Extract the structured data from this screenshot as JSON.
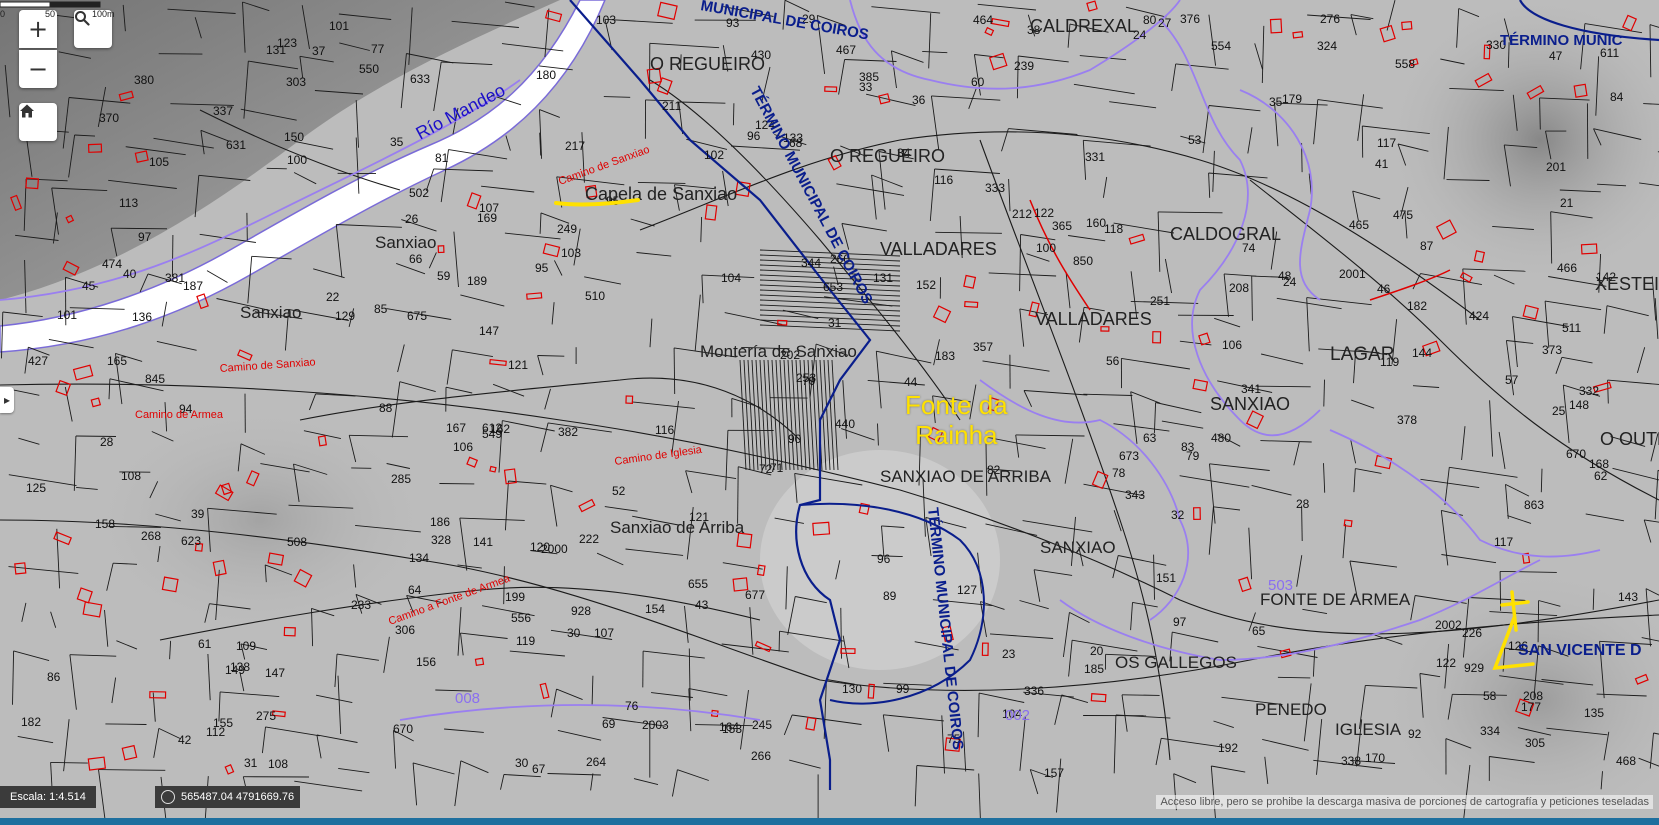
{
  "controls": {
    "zoom_in": "+",
    "zoom_out": "−",
    "search_icon": "search-icon",
    "home_icon": "home-icon"
  },
  "scale": {
    "label": "Escala: 1:4.514",
    "ticks": [
      "0",
      "50",
      "100m"
    ]
  },
  "coordinates": "565487.04  4791669.76",
  "attribution": "Acceso libre, pero se prohibe la descarga masiva de porciones de cartografía y peticiones teseladas",
  "colors": {
    "terrain": "#bdbdbd",
    "parcel_line": "#1a1a1a",
    "municipal_border": "#0a1e8c",
    "parish_border": "#9a7ff0",
    "river": "#ffffff",
    "road_label": "#e00000",
    "annotation": "#ffe100"
  },
  "places": [
    {
      "id": "o-regueiro-1",
      "text": "O REGUEIRO"
    },
    {
      "id": "o-regueiro-2",
      "text": "O REGUEIRO"
    },
    {
      "id": "caldrexal",
      "text": "CALDREXAL"
    },
    {
      "id": "caldogral",
      "text": "CALDOGRAL"
    },
    {
      "id": "valladares-1",
      "text": "VALLADARES"
    },
    {
      "id": "valladares-2",
      "text": "VALLADARES"
    },
    {
      "id": "lagar",
      "text": "LAGAR"
    },
    {
      "id": "sanxiao-caps",
      "text": "SANXIAO"
    },
    {
      "id": "sanxiao-de-arriba",
      "text": "SANXIAO DE ARRIBA"
    },
    {
      "id": "sanxiao-caps-2",
      "text": "SANXIAO"
    },
    {
      "id": "fonte-de-armea",
      "text": "FONTE DE ARMEA"
    },
    {
      "id": "os-gallegos",
      "text": "OS GALLEGOS"
    },
    {
      "id": "penedo",
      "text": "PENEDO"
    },
    {
      "id": "iglesia",
      "text": "IGLESIA"
    },
    {
      "id": "san-vicente",
      "text": "SAN VICENTE D"
    },
    {
      "id": "xesteira",
      "text": "XESTEIR"
    },
    {
      "id": "o-outeiro",
      "text": "O OUTE"
    },
    {
      "id": "capela",
      "text": "Capela de Sanxiao"
    },
    {
      "id": "sanxiao-1",
      "text": "Sanxiao"
    },
    {
      "id": "sanxiao-2",
      "text": "Sanxiao"
    },
    {
      "id": "monteria",
      "text": "Montería de Sanxiao"
    },
    {
      "id": "sanxiao-de-arriba-lower",
      "text": "Sanxiao de Arriba"
    },
    {
      "id": "rio-mandeo",
      "text": "Río Mandeo"
    },
    {
      "id": "termino-1",
      "text": "TÉRMINO MUNICIPAL DE COIROS"
    },
    {
      "id": "termino-2",
      "text": "TÉRMINO MUNICIPAL DE COIROS"
    },
    {
      "id": "termino-3",
      "text": "TÉRMINO MUNICIPAL DE COIROS"
    },
    {
      "id": "termino-4",
      "text": "TÉRMINO MUNIC"
    },
    {
      "id": "mpal-top",
      "text": "MUNICIPAL DE COIROS"
    },
    {
      "id": "zone-503",
      "text": "503"
    },
    {
      "id": "zone-008",
      "text": "008"
    },
    {
      "id": "zone-002",
      "text": "002"
    }
  ],
  "road_labels": [
    {
      "id": "camino-sanxiao-1",
      "text": "Camino de Sanxiao"
    },
    {
      "id": "camino-sanxiao-2",
      "text": "Camino de Sanxiao"
    },
    {
      "id": "camino-de-armea",
      "text": "Camino de Armea"
    },
    {
      "id": "camino-de-iglesia",
      "text": "Camino de Iglesia"
    },
    {
      "id": "camino-a-fonte",
      "text": "Camino a Fonte de Armea"
    }
  ],
  "annotations": {
    "fonte_line1": "Fonte da",
    "fonte_line2": "Rainha"
  },
  "parcel_numbers": [
    "670",
    "677",
    "675",
    "673",
    "850",
    "845",
    "929",
    "863",
    "928",
    "20",
    "31",
    "30",
    "28",
    "35",
    "23",
    "24",
    "27",
    "336",
    "338",
    "324",
    "328",
    "334",
    "333",
    "331",
    "330",
    "376",
    "380",
    "97",
    "95",
    "94",
    "96",
    "100",
    "101",
    "103",
    "104",
    "612",
    "611",
    "106",
    "107",
    "108",
    "112",
    "116",
    "117",
    "118",
    "119",
    "120",
    "121",
    "122",
    "123",
    "125",
    "129",
    "131",
    "134",
    "138",
    "141",
    "142",
    "143",
    "144",
    "147",
    "148",
    "149",
    "150",
    "151",
    "152",
    "153",
    "154",
    "155",
    "156",
    "157",
    "158",
    "160",
    "162",
    "164",
    "165",
    "167",
    "168",
    "169",
    "170",
    "179",
    "180",
    "182",
    "185",
    "186",
    "187",
    "192",
    "199",
    "208",
    "211",
    "212",
    "217",
    "222",
    "226",
    "233",
    "239",
    "245",
    "249",
    "251",
    "253",
    "260",
    "264",
    "266",
    "268",
    "275",
    "276",
    "285",
    "303",
    "305",
    "306",
    "332",
    "337",
    "341",
    "343",
    "344",
    "357",
    "365",
    "370",
    "373",
    "378",
    "381",
    "382",
    "385",
    "424",
    "427",
    "430",
    "440",
    "464",
    "465",
    "466",
    "467",
    "468",
    "474",
    "475",
    "480",
    "502",
    "508",
    "510",
    "511",
    "549",
    "550",
    "554",
    "556",
    "558",
    "623",
    "631",
    "633",
    "653",
    "655",
    "670",
    "21",
    "22",
    "24",
    "25",
    "26",
    "28",
    "29",
    "30",
    "31",
    "32",
    "33",
    "34",
    "35",
    "36",
    "37",
    "38",
    "39",
    "40",
    "41",
    "42",
    "43",
    "44",
    "45",
    "46",
    "47",
    "48",
    "52",
    "53",
    "56",
    "57",
    "58",
    "59",
    "60",
    "61",
    "62",
    "63",
    "64",
    "65",
    "66",
    "67",
    "68",
    "69",
    "70",
    "71",
    "72",
    "74",
    "75",
    "76",
    "77",
    "78",
    "79",
    "80",
    "81",
    "82",
    "83",
    "84",
    "85",
    "86",
    "87",
    "88",
    "89",
    "90",
    "92",
    "93",
    "95",
    "96",
    "97",
    "99",
    "100",
    "101",
    "102",
    "103",
    "104",
    "105",
    "106",
    "107",
    "108",
    "109",
    "113",
    "116",
    "117",
    "119",
    "121",
    "122",
    "124",
    "126",
    "127",
    "130",
    "131",
    "133",
    "135",
    "136",
    "147",
    "177",
    "182",
    "183",
    "189",
    "201",
    "202",
    "208",
    "2000",
    "2001",
    "2002",
    "2003"
  ]
}
